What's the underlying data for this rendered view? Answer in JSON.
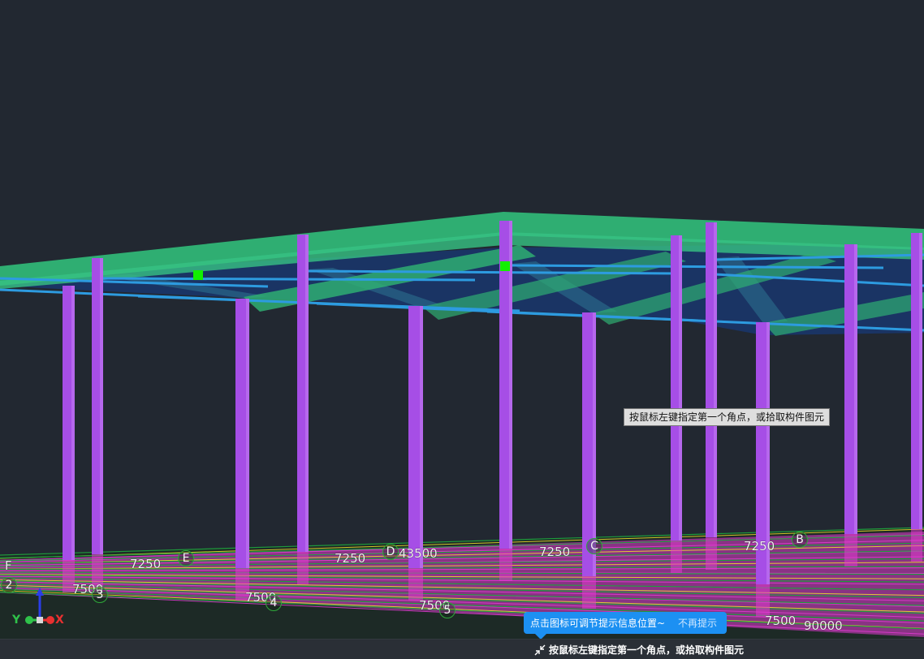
{
  "scene": {
    "dimension_labels": [
      "7250",
      "7250",
      "43500",
      "7250",
      "7250",
      "7500",
      "7500",
      "7500",
      "7500",
      "90000"
    ],
    "axis_labels": [
      "F",
      "E",
      "D",
      "C",
      "B",
      "2",
      "3",
      "4",
      "5"
    ],
    "colors": {
      "background": "#222831",
      "column": "#a64ee6",
      "roof_slab": "#2fae72",
      "purlin": "#2d9be0",
      "marker": "#12f000",
      "ground_grid": "#1f9a3c",
      "rebar_magenta": "#e23bd2",
      "rebar_yellow": "#f0e12a"
    }
  },
  "cursor_tooltip": "按鼠标左键指定第一个角点，或拾取构件图元",
  "hint_popup": {
    "text": "点击图标可调节提示信息位置~",
    "dismiss": "不再提示"
  },
  "status_bar": {
    "icon": "adjust-position-icon",
    "prompt": "按鼠标左键指定第一个角点，或拾取构件图元"
  },
  "axis_gizmo": {
    "x_label": "X",
    "y_label": "Y",
    "x_color": "#e83030",
    "y_color": "#2fc24a",
    "z_color": "#2a3de8"
  }
}
